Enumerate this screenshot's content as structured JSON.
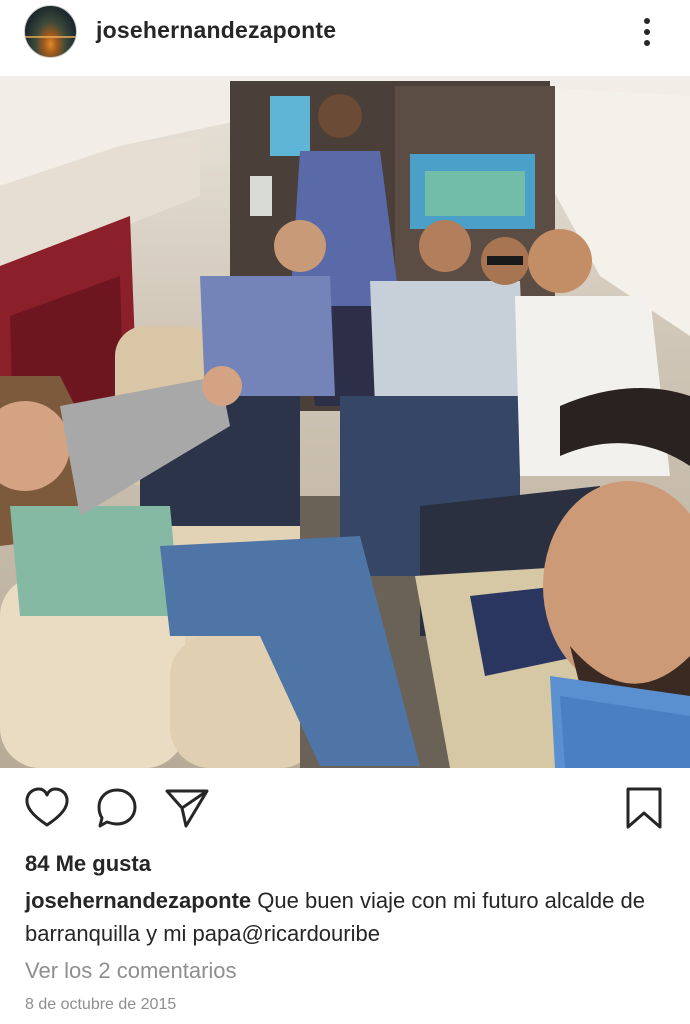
{
  "post": {
    "username": "josehernandezaponte",
    "likes_text": "84 Me gusta",
    "caption_user": "josehernandezaponte",
    "caption_text": "Que buen viaje con mi futuro alcalde de barranquilla y mi papa@ricardouribe",
    "view_comments": "Ver los 2 comentarios",
    "date": "8 de octubre de 2015"
  },
  "icons": {
    "more": "more-options-icon",
    "like": "heart-icon",
    "comment": "comment-icon",
    "share": "send-icon",
    "save": "bookmark-icon"
  },
  "colors": {
    "text": "#262626",
    "muted": "#8e8e8e",
    "background": "#ffffff"
  }
}
